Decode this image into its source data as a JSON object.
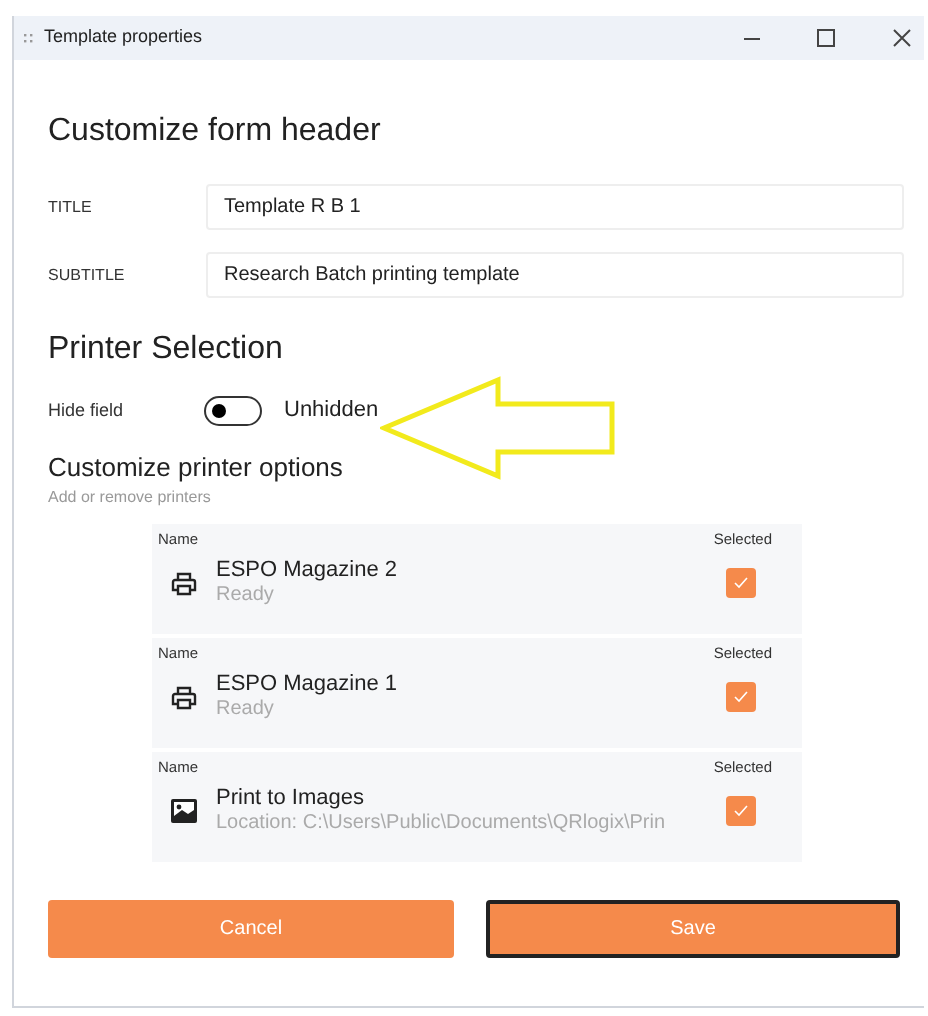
{
  "window": {
    "title": "Template properties"
  },
  "form_header": {
    "heading": "Customize form header",
    "fields": [
      {
        "label": "TITLE",
        "value": "Template R B 1"
      },
      {
        "label": "SUBTITLE",
        "value": "Research Batch printing template"
      }
    ]
  },
  "printer_selection": {
    "heading": "Printer Selection",
    "hide_field": {
      "label": "Hide field",
      "on": false,
      "state_text": "Unhidden"
    },
    "options_heading": "Customize printer options",
    "options_subheading": "Add or remove printers",
    "printers": [
      {
        "kind": "printer",
        "name_header": "Name",
        "selected_header": "Selected",
        "name": "ESPO Magazine 2",
        "detail": "Ready",
        "selected": true
      },
      {
        "kind": "printer",
        "name_header": "Name",
        "selected_header": "Selected",
        "name": "ESPO Magazine 1",
        "detail": "Ready",
        "selected": true
      },
      {
        "kind": "image",
        "name_header": "Name",
        "selected_header": "Selected",
        "name": "Print to Images",
        "detail": "Location: C:\\Users\\Public\\Documents\\QRlogix\\Prin",
        "selected": true
      }
    ]
  },
  "buttons": [
    {
      "label": "Cancel",
      "focused": false
    },
    {
      "label": "Save",
      "focused": true
    }
  ]
}
